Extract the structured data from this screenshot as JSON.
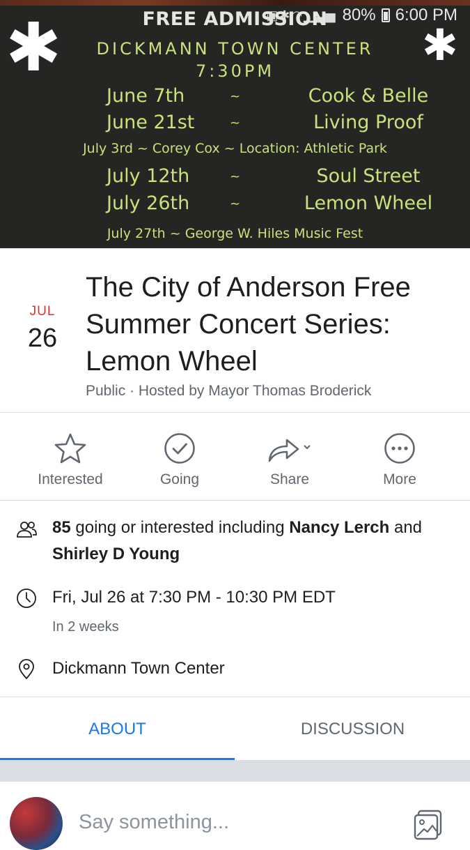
{
  "status_bar": {
    "battery": "80%",
    "time": "6:00 PM",
    "icons": [
      "nfc-icon",
      "bluetooth-icon",
      "wifi-icon",
      "signal-icon",
      "battery-icon"
    ]
  },
  "banner": {
    "admission": "FREE ADMISSION",
    "venue": "DICKMANN TOWN CENTER",
    "time": "7:30PM",
    "schedule": [
      {
        "date": "June 7th",
        "sep": "~",
        "act": "Cook & Belle"
      },
      {
        "date": "June 21st",
        "sep": "~",
        "act": "Living Proof"
      },
      {
        "line": "July 3rd ~ Corey Cox ~ Location: Athletic Park"
      },
      {
        "date": "July 12th",
        "sep": "~",
        "act": "Soul Street"
      },
      {
        "date": "July 26th",
        "sep": "~",
        "act": "Lemon Wheel"
      },
      {
        "line": "July 27th ~ George W. Hiles Music Fest"
      }
    ],
    "colors": {
      "background": "#252523",
      "text": "#c9e27a"
    }
  },
  "event": {
    "month": "JUL",
    "day": "26",
    "title_lines": [
      "The City of Anderson Free",
      "Summer Concert Series:",
      "Lemon Wheel"
    ],
    "subtitle": "Public · Hosted by Mayor Thomas Broderick"
  },
  "actions": [
    {
      "label": "Interested",
      "icon": "star-icon"
    },
    {
      "label": "Going",
      "icon": "check-circle-icon"
    },
    {
      "label": "Share",
      "icon": "share-icon"
    },
    {
      "label": "More",
      "icon": "more-icon"
    }
  ],
  "info": {
    "count": "85",
    "going_text": " going or interested including ",
    "name1": "Nancy Lerch",
    "and": " and",
    "name2": "Shirley D Young",
    "datetime": "Fri, Jul 26 at 7:30 PM - 10:30 PM EDT",
    "relative": "In 2 weeks",
    "location": "Dickmann Town Center"
  },
  "tabs": [
    {
      "label": "ABOUT",
      "active": true
    },
    {
      "label": "DISCUSSION",
      "active": false
    }
  ],
  "composer": {
    "placeholder": "Say something..."
  },
  "colors": {
    "accent": "#1877f2",
    "date_red": "#e0302a",
    "secondary_text": "#606770",
    "divider": "#dadde1"
  }
}
